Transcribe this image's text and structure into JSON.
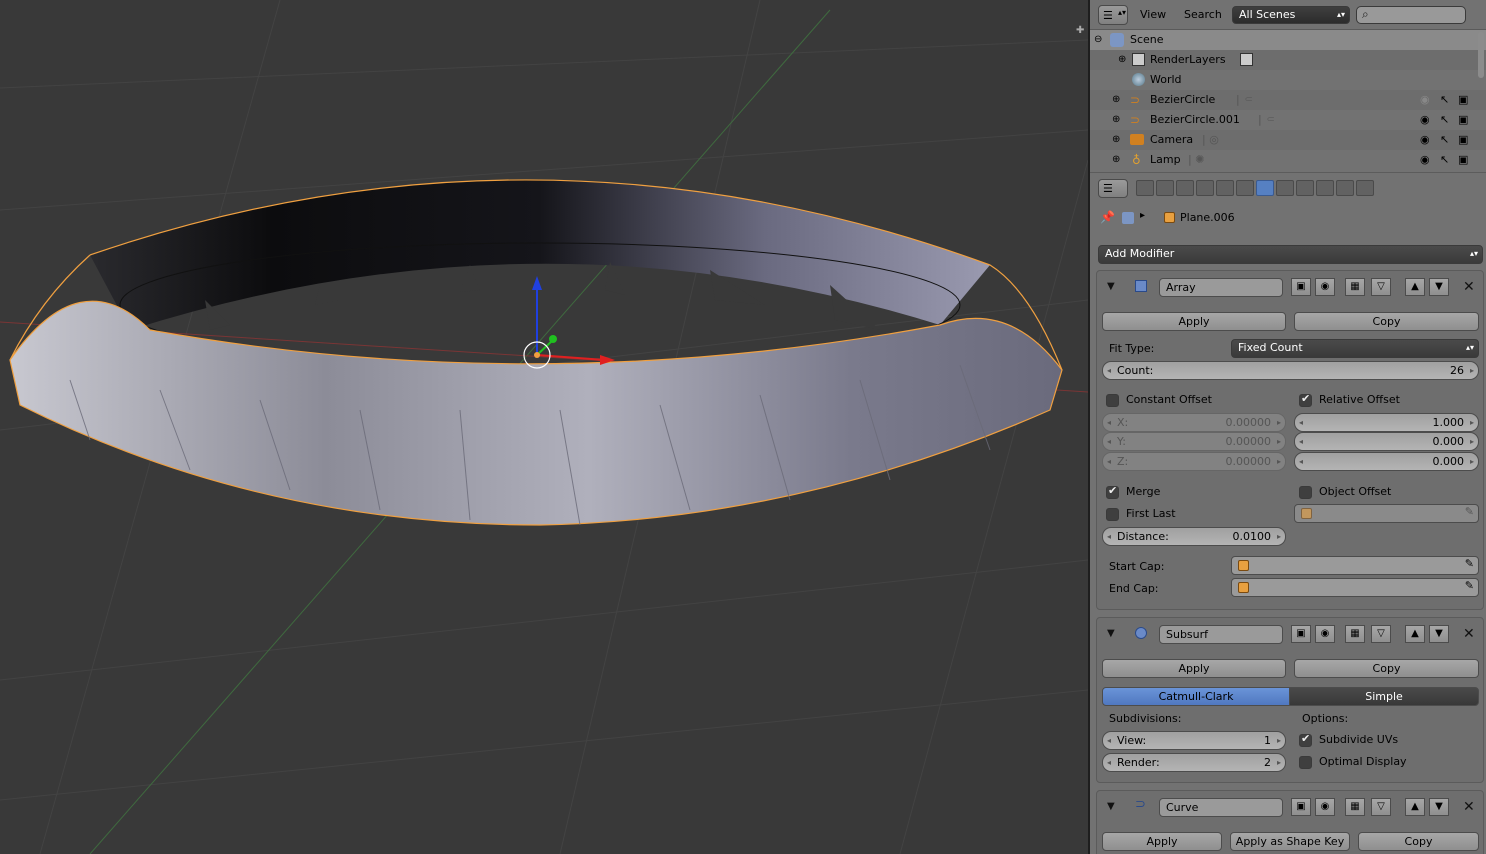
{
  "outliner": {
    "header": {
      "view": "View",
      "search": "Search",
      "scenes": "All Scenes"
    },
    "items": [
      {
        "label": "Scene",
        "icon": "scene-icon"
      },
      {
        "label": "RenderLayers",
        "icon": "renderlayers-icon"
      },
      {
        "label": "World",
        "icon": "world-icon"
      },
      {
        "label": "BezierCircle",
        "icon": "curve-icon"
      },
      {
        "label": "BezierCircle.001",
        "icon": "curve-icon"
      },
      {
        "label": "Camera",
        "icon": "camera-icon"
      },
      {
        "label": "Lamp",
        "icon": "lamp-icon"
      }
    ]
  },
  "properties": {
    "object_name": "Plane.006",
    "add_modifier": "Add Modifier",
    "array": {
      "name": "Array",
      "apply": "Apply",
      "copy": "Copy",
      "fit_type_label": "Fit Type:",
      "fit_type_value": "Fixed Count",
      "count_label": "Count:",
      "count_value": "26",
      "constant_offset": "Constant Offset",
      "relative_offset": "Relative Offset",
      "x_label": "X:",
      "x_value": "0.00000",
      "y_label": "Y:",
      "y_value": "0.00000",
      "z_label": "Z:",
      "z_value": "0.00000",
      "rel_x": "1.000",
      "rel_y": "0.000",
      "rel_z": "0.000",
      "merge": "Merge",
      "object_offset": "Object Offset",
      "first_last": "First Last",
      "distance_label": "Distance:",
      "distance_value": "0.0100",
      "start_cap": "Start Cap:",
      "end_cap": "End Cap:"
    },
    "subsurf": {
      "name": "Subsurf",
      "apply": "Apply",
      "copy": "Copy",
      "catmull": "Catmull-Clark",
      "simple": "Simple",
      "subdivisions": "Subdivisions:",
      "options": "Options:",
      "view_label": "View:",
      "view_value": "1",
      "render_label": "Render:",
      "render_value": "2",
      "subdivide_uvs": "Subdivide UVs",
      "optimal_display": "Optimal Display"
    },
    "curve": {
      "name": "Curve",
      "apply": "Apply",
      "apply_shape": "Apply as Shape Key",
      "copy": "Copy"
    }
  },
  "colors": {
    "accent": "#5680c2",
    "selection": "#f0a040",
    "background": "#393939"
  }
}
